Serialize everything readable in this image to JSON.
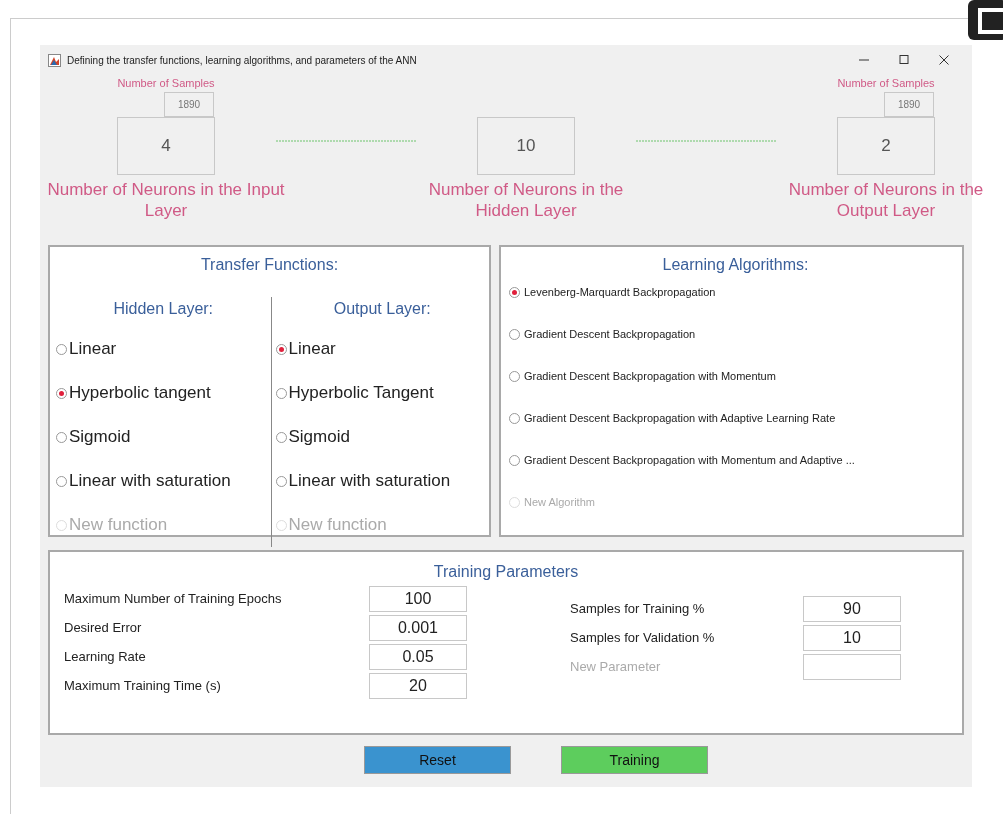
{
  "window": {
    "title": "Defining the transfer functions, learning algorithms, and parameters of the ANN"
  },
  "layers": [
    {
      "samples_label": "Number of Samples",
      "samples": "1890",
      "neurons": "4",
      "label": "Number of Neurons in the Input Layer"
    },
    {
      "neurons": "10",
      "label": "Number of Neurons in the Hidden Layer"
    },
    {
      "samples_label": "Number of Samples",
      "samples": "1890",
      "neurons": "2",
      "label": "Number of Neurons in the Output Layer"
    }
  ],
  "transfer_functions": {
    "title": "Transfer Functions:",
    "columns": [
      {
        "title": "Hidden Layer:",
        "options": [
          {
            "label": "Linear",
            "selected": false,
            "disabled": false
          },
          {
            "label": "Hyperbolic tangent",
            "selected": true,
            "disabled": false
          },
          {
            "label": "Sigmoid",
            "selected": false,
            "disabled": false
          },
          {
            "label": "Linear with saturation",
            "selected": false,
            "disabled": false
          },
          {
            "label": "New function",
            "selected": false,
            "disabled": true
          }
        ]
      },
      {
        "title": "Output Layer:",
        "options": [
          {
            "label": "Linear",
            "selected": true,
            "disabled": false
          },
          {
            "label": "Hyperbolic Tangent",
            "selected": false,
            "disabled": false
          },
          {
            "label": "Sigmoid",
            "selected": false,
            "disabled": false
          },
          {
            "label": "Linear with saturation",
            "selected": false,
            "disabled": false
          },
          {
            "label": "New function",
            "selected": false,
            "disabled": true
          }
        ]
      }
    ]
  },
  "learning_algorithms": {
    "title": "Learning Algorithms:",
    "options": [
      {
        "label": "Levenberg-Marquardt Backpropagation",
        "selected": true,
        "disabled": false
      },
      {
        "label": "Gradient Descent Backpropagation",
        "selected": false,
        "disabled": false
      },
      {
        "label": "Gradient Descent Backpropagation with Momentum",
        "selected": false,
        "disabled": false
      },
      {
        "label": "Gradient Descent Backpropagation with Adaptive Learning Rate",
        "selected": false,
        "disabled": false
      },
      {
        "label": "Gradient Descent Backpropagation with Momentum and Adaptive ...",
        "selected": false,
        "disabled": false
      },
      {
        "label": "New Algorithm",
        "selected": false,
        "disabled": true
      }
    ]
  },
  "training_parameters": {
    "title": "Training Parameters",
    "left": [
      {
        "label": "Maximum Number of Training Epochs",
        "value": "100",
        "disabled": false
      },
      {
        "label": "Desired Error",
        "value": "0.001",
        "disabled": false
      },
      {
        "label": "Learning Rate",
        "value": "0.05",
        "disabled": false
      },
      {
        "label": "Maximum Training Time (s)",
        "value": "20",
        "disabled": false
      }
    ],
    "right": [
      {
        "label": "Samples for Training %",
        "value": "90",
        "disabled": false
      },
      {
        "label": "Samples for Validation %",
        "value": "10",
        "disabled": false
      },
      {
        "label": "New Parameter",
        "disabled": true
      }
    ]
  },
  "buttons": [
    {
      "label": "Reset",
      "kind": "reset"
    },
    {
      "label": "Training",
      "kind": "train"
    }
  ]
}
